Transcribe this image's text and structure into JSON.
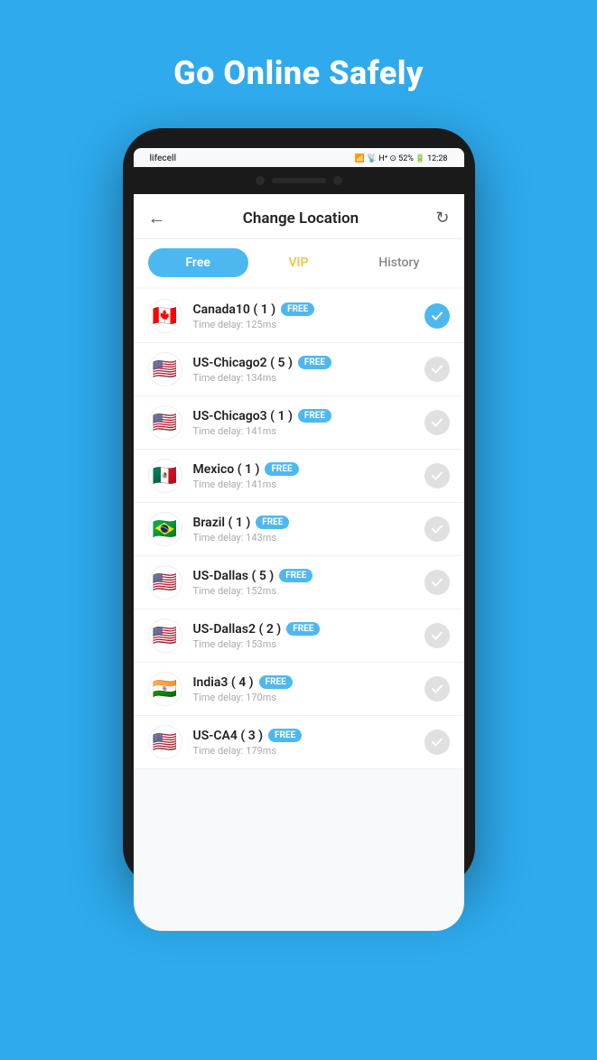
{
  "page": {
    "background_color": "#2eaaed",
    "headline": "Go Online Safely"
  },
  "phone": {
    "status_bar": {
      "carrier": "lifecell",
      "signal_icons": "▂▄▆█",
      "icons_right": "⊙ 52%",
      "time": "12:28"
    },
    "header": {
      "back_label": "←",
      "title": "Change Location",
      "refresh_label": "↻"
    },
    "tabs": [
      {
        "id": "free",
        "label": "Free",
        "active": true
      },
      {
        "id": "vip",
        "label": "VIP",
        "active": false
      },
      {
        "id": "history",
        "label": "History",
        "active": false
      }
    ],
    "locations": [
      {
        "flag": "🇨🇦",
        "name": "Canada10 ( 1 )",
        "badge": "FREE",
        "delay": "Time delay: 125ms",
        "selected": true
      },
      {
        "flag": "🇺🇸",
        "name": "US-Chicago2 ( 5 )",
        "badge": "FREE",
        "delay": "Time delay: 134ms",
        "selected": false
      },
      {
        "flag": "🇺🇸",
        "name": "US-Chicago3 ( 1 )",
        "badge": "FREE",
        "delay": "Time delay: 141ms",
        "selected": false
      },
      {
        "flag": "🇲🇽",
        "name": "Mexico ( 1 )",
        "badge": "FREE",
        "delay": "Time delay: 141ms",
        "selected": false
      },
      {
        "flag": "🇧🇷",
        "name": "Brazil ( 1 )",
        "badge": "FREE",
        "delay": "Time delay: 143ms",
        "selected": false
      },
      {
        "flag": "🇺🇸",
        "name": "US-Dallas ( 5 )",
        "badge": "FREE",
        "delay": "Time delay: 152ms",
        "selected": false
      },
      {
        "flag": "🇺🇸",
        "name": "US-Dallas2 ( 2 )",
        "badge": "FREE",
        "delay": "Time delay: 153ms",
        "selected": false
      },
      {
        "flag": "🇮🇳",
        "name": "India3 ( 4 )",
        "badge": "FREE",
        "delay": "Time delay: 170ms",
        "selected": false
      },
      {
        "flag": "🇺🇸",
        "name": "US-CA4 ( 3 )",
        "badge": "FREE",
        "delay": "Time delay: 179ms",
        "selected": false
      }
    ]
  }
}
